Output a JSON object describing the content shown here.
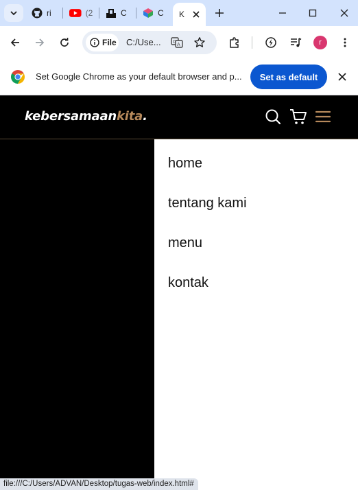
{
  "browser": {
    "tabs": [
      {
        "title": "ri",
        "icon": "github-icon"
      },
      {
        "title": "(2",
        "icon": "youtube-icon"
      },
      {
        "title": "C",
        "icon": "app-icon"
      },
      {
        "title": "C",
        "icon": "app-icon"
      },
      {
        "title": "K",
        "icon": "blank-page-icon",
        "active": true
      }
    ],
    "toolbar": {
      "chip_label": "File",
      "url": "C:/Use..."
    },
    "avatar_initial": "r",
    "infobar": {
      "message": "Set Google Chrome as your default browser and p...",
      "button_label": "Set as default"
    },
    "status_url": "file:///C:/Users/ADVAN/Desktop/tugas-web/index.html#"
  },
  "site": {
    "logo_main": "kebersamaan",
    "logo_accent": "kita",
    "logo_dot": ".",
    "accent_color": "#b6895b",
    "menu": [
      {
        "label": "home"
      },
      {
        "label": "tentang kami"
      },
      {
        "label": "menu"
      },
      {
        "label": "kontak"
      }
    ]
  }
}
